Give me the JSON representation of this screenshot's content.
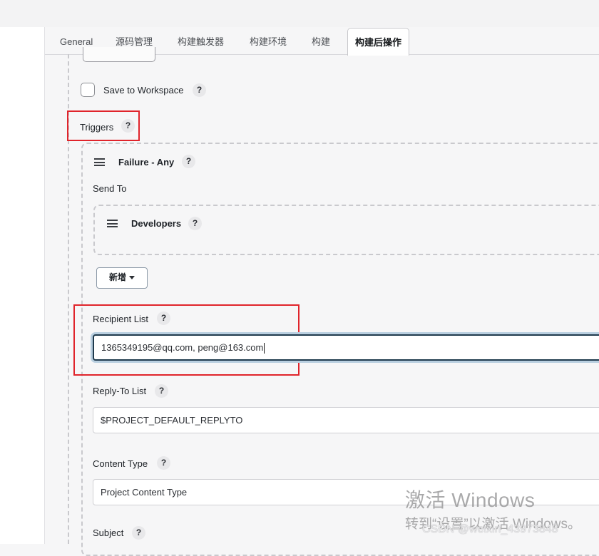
{
  "tabs": [
    {
      "label": "General"
    },
    {
      "label": "源码管理"
    },
    {
      "label": "构建触发器"
    },
    {
      "label": "构建环境"
    },
    {
      "label": "构建"
    },
    {
      "label": "构建后操作"
    }
  ],
  "active_tab": "构建后操作",
  "save_workspace": {
    "label": "Save to Workspace",
    "checked": false
  },
  "help_glyph": "?",
  "triggers": {
    "label": "Triggers",
    "trigger": {
      "name": "Failure - Any",
      "send_to_label": "Send To",
      "recipients": [
        {
          "name": "Developers"
        }
      ],
      "add_button_label": "新增"
    }
  },
  "fields": {
    "recipient_list": {
      "label": "Recipient List",
      "value": "1365349195@qq.com, peng@163.com"
    },
    "reply_to_list": {
      "label": "Reply-To List",
      "value": "$PROJECT_DEFAULT_REPLYTO"
    },
    "content_type": {
      "label": "Content Type",
      "value": "Project Content Type"
    },
    "subject": {
      "label": "Subject"
    }
  },
  "watermark": {
    "line1": "激活 Windows",
    "line2": "转到“设置”以激活 Windows。",
    "csdn": "CSDN @weixin_43973848"
  },
  "colors": {
    "highlight": "#e0242b",
    "focus_ring": "#b9cfe0"
  }
}
